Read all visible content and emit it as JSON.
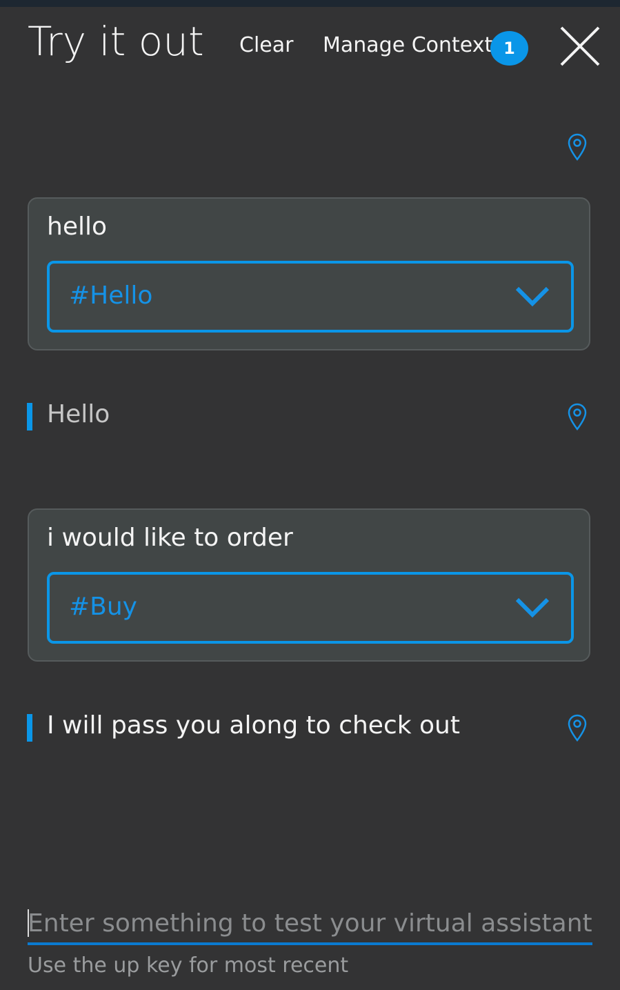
{
  "header": {
    "title": "Try it out",
    "clear_label": "Clear",
    "manage_context_label": "Manage Context",
    "context_count": "1"
  },
  "conversation": [
    {
      "user_message": "hello",
      "intent": "#Hello",
      "reply": "Hello"
    },
    {
      "user_message": "i would like to order",
      "intent": "#Buy",
      "reply": "I will pass you along to check out"
    }
  ],
  "input": {
    "placeholder": "Enter something to test your virtual assistant",
    "hint": "Use the up key for most recent"
  },
  "colors": {
    "accent": "#0a96e8",
    "background": "#333334",
    "card": "#414646"
  },
  "icons": {
    "close": "close-icon",
    "pin": "location-pin-icon",
    "dropdown": "chevron-down-icon"
  }
}
